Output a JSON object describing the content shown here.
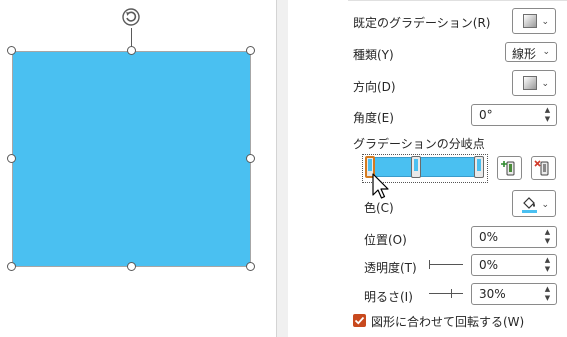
{
  "panel": {
    "preset_gradients_label": "既定のグラデーション(R)",
    "type_label": "種類(Y)",
    "type_value": "線形",
    "direction_label": "方向(D)",
    "angle_label": "角度(E)",
    "angle_value": "0°",
    "gradient_stops_label": "グラデーションの分岐点",
    "color_label": "色(C)",
    "position_label": "位置(O)",
    "position_value": "0%",
    "transparency_label": "透明度(T)",
    "transparency_value": "0%",
    "brightness_label": "明るさ(I)",
    "brightness_value": "30%",
    "rotate_with_shape_label": "図形に合わせて回転する(W)",
    "rotate_with_shape_checked": true
  },
  "icons": {
    "rotate": "rotate-handle-icon",
    "add_stop": "add-gradient-stop-icon",
    "remove_stop": "remove-gradient-stop-icon",
    "paint_bucket": "paint-bucket-icon",
    "cursor": "mouse-pointer-icon"
  },
  "colors": {
    "shape_fill": "#4ac0f1",
    "selection_accent": "#d47a20",
    "checkbox_fill": "#c8491e"
  },
  "gradient_stops": [
    {
      "position": 0,
      "selected": true
    },
    {
      "position": 0.42,
      "selected": false
    },
    {
      "position": 1,
      "selected": false
    }
  ]
}
